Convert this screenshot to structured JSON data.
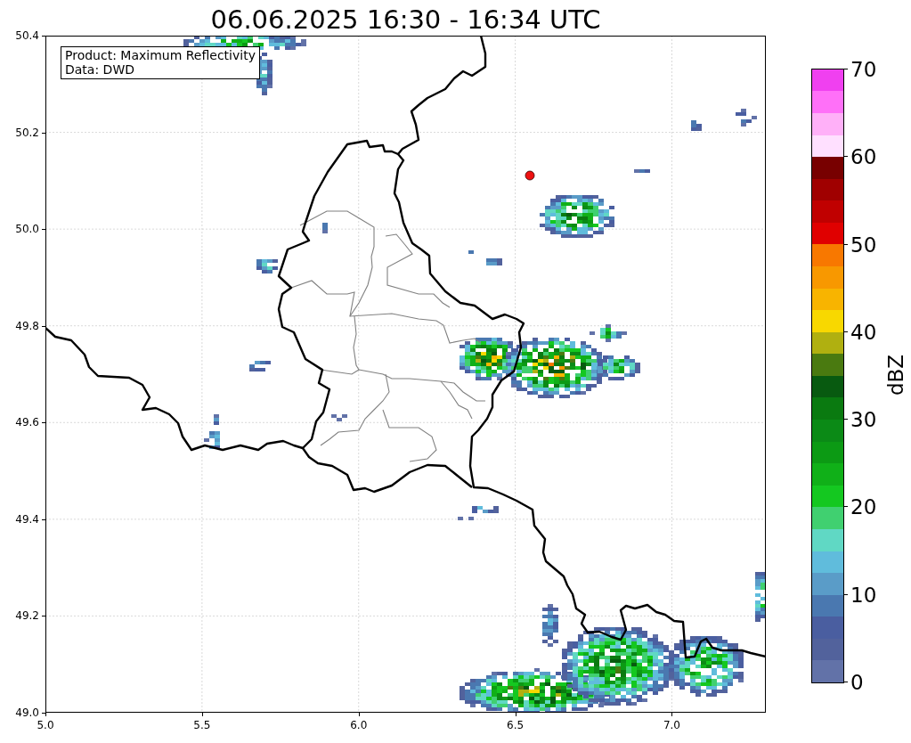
{
  "title": "06.06.2025 16:30 - 16:34 UTC",
  "info_box": {
    "lines": [
      "Product: Maximum Reflectivity",
      "Data: DWD"
    ]
  },
  "map": {
    "xticks": [
      "5.0",
      "5.5",
      "6.0",
      "6.5",
      "7.0"
    ],
    "yticks": [
      "50.4",
      "50.2",
      "50.0",
      "49.8",
      "49.6",
      "49.4",
      "49.2",
      "49.0"
    ]
  },
  "colorbar": {
    "label": "dBZ",
    "ticks": [
      "70",
      "60",
      "50",
      "40",
      "30",
      "20",
      "10",
      "0"
    ],
    "segments": [
      {
        "color": "#6272a8"
      },
      {
        "color": "#52629c"
      },
      {
        "color": "#4a5ea0"
      },
      {
        "color": "#4a78b0"
      },
      {
        "color": "#5a9cc8"
      },
      {
        "color": "#60bcdc"
      },
      {
        "color": "#60d8c4"
      },
      {
        "color": "#40d070"
      },
      {
        "color": "#14c820"
      },
      {
        "color": "#10b018"
      },
      {
        "color": "#0c9a14"
      },
      {
        "color": "#0b8a16"
      },
      {
        "color": "#0a7a10"
      },
      {
        "color": "#085a10"
      },
      {
        "color": "#4a7a10"
      },
      {
        "color": "#b0b010"
      },
      {
        "color": "#f8d800"
      },
      {
        "color": "#f8b400"
      },
      {
        "color": "#f89800"
      },
      {
        "color": "#f87800"
      },
      {
        "color": "#e00000"
      },
      {
        "color": "#c00000"
      },
      {
        "color": "#a00000"
      },
      {
        "color": "#780000"
      },
      {
        "color": "#ffe0ff"
      },
      {
        "color": "#ffb0f8"
      },
      {
        "color": "#ff70f8"
      },
      {
        "color": "#f040f0"
      }
    ]
  }
}
